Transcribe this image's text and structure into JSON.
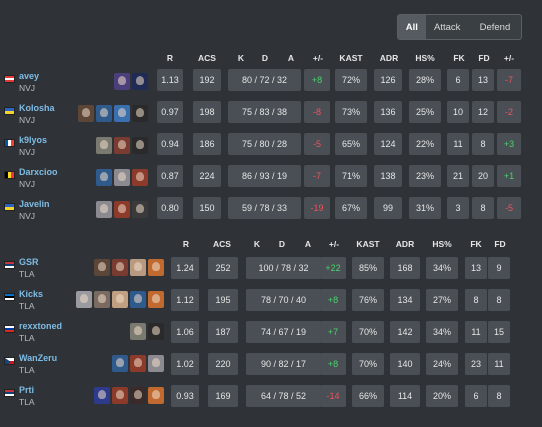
{
  "filter": {
    "options": [
      "All",
      "Attack",
      "Defend"
    ],
    "selected": "All"
  },
  "headers": [
    "R",
    "ACS",
    "K",
    "D",
    "A",
    "+/-",
    "KAST",
    "ADR",
    "HS%",
    "FK",
    "FD",
    "+/-"
  ],
  "team1": [
    {
      "name": "avey",
      "team": "NVJ",
      "flag": "lb",
      "agents": [
        "#4a3f7a",
        "#1f2b55"
      ],
      "r": "1.13",
      "acs": "192",
      "kda": "80 / 72 / 32",
      "pm": "+8",
      "pm_sign": "pos",
      "kast": "72%",
      "adr": "126",
      "hs": "28%",
      "fk": "6",
      "fd": "13",
      "fkpm": "-7",
      "fkpm_sign": "neg"
    },
    {
      "name": "Kolosha",
      "team": "NVJ",
      "flag": "ua",
      "agents": [
        "#5b4638",
        "#2e5a8c",
        "#3a6fb0",
        "#2a2a2a"
      ],
      "r": "0.97",
      "acs": "198",
      "kda": "75 / 83 / 38",
      "pm": "-8",
      "pm_sign": "neg",
      "kast": "73%",
      "adr": "136",
      "hs": "25%",
      "fk": "10",
      "fd": "12",
      "fkpm": "-2",
      "fkpm_sign": "neg"
    },
    {
      "name": "k9lyos",
      "team": "NVJ",
      "flag": "fr",
      "agents": [
        "#7a7a70",
        "#7a3b30",
        "#2a2a2a"
      ],
      "r": "0.94",
      "acs": "186",
      "kda": "75 / 80 / 28",
      "pm": "-5",
      "pm_sign": "neg",
      "kast": "65%",
      "adr": "124",
      "hs": "22%",
      "fk": "11",
      "fd": "8",
      "fkpm": "+3",
      "fkpm_sign": "pos"
    },
    {
      "name": "Darxcioo",
      "team": "NVJ",
      "flag": "be",
      "agents": [
        "#2e5a8c",
        "#8a8a90",
        "#8c3a2a"
      ],
      "r": "0.87",
      "acs": "224",
      "kda": "86 / 93 / 19",
      "pm": "-7",
      "pm_sign": "neg",
      "kast": "71%",
      "adr": "138",
      "hs": "23%",
      "fk": "21",
      "fd": "20",
      "fkpm": "+1",
      "fkpm_sign": "pos"
    },
    {
      "name": "Javelin",
      "team": "NVJ",
      "flag": "ua",
      "agents": [
        "#8a8a90",
        "#8c3a2a",
        "#3a3a3a"
      ],
      "r": "0.80",
      "acs": "150",
      "kda": "59 / 78 / 33",
      "pm": "-19",
      "pm_sign": "neg",
      "kast": "67%",
      "adr": "99",
      "hs": "31%",
      "fk": "3",
      "fd": "8",
      "fkpm": "-5",
      "fkpm_sign": "neg"
    }
  ],
  "team2": [
    {
      "name": "GSR",
      "team": "TLA",
      "flag": "rs",
      "agents": [
        "#5b4638",
        "#7a3b30",
        "#b89a80",
        "#c06a30"
      ],
      "r": "1.24",
      "acs": "252",
      "kda": "100 / 78 / 32",
      "pm": "+22",
      "pm_sign": "pos",
      "kast": "85%",
      "adr": "168",
      "hs": "34%",
      "fk": "13",
      "fd": "9"
    },
    {
      "name": "Kicks",
      "team": "TLA",
      "flag": "ee",
      "agents": [
        "#9a9aa0",
        "#7a6a60",
        "#c0a080",
        "#2e5a8c",
        "#c06a30"
      ],
      "r": "1.12",
      "acs": "195",
      "kda": "78 / 70 / 40",
      "pm": "+8",
      "pm_sign": "pos",
      "kast": "76%",
      "adr": "134",
      "hs": "27%",
      "fk": "8",
      "fd": "8"
    },
    {
      "name": "rexxtoned",
      "team": "TLA",
      "flag": "ru",
      "agents": [
        "#7a7a70",
        "#2a2a2a"
      ],
      "r": "1.06",
      "acs": "187",
      "kda": "74 / 67 / 19",
      "pm": "+7",
      "pm_sign": "pos",
      "kast": "70%",
      "adr": "142",
      "hs": "34%",
      "fk": "11",
      "fd": "15"
    },
    {
      "name": "WanZeru",
      "team": "TLA",
      "flag": "cz",
      "agents": [
        "#2e5a8c",
        "#8c3a2a",
        "#8a8a90"
      ],
      "r": "1.02",
      "acs": "220",
      "kda": "90 / 82 / 17",
      "pm": "+8",
      "pm_sign": "pos",
      "kast": "70%",
      "adr": "140",
      "hs": "24%",
      "fk": "23",
      "fd": "11"
    },
    {
      "name": "Prti",
      "team": "TLA",
      "flag": "rs",
      "agents": [
        "#2e3a8c",
        "#8c3a2a",
        "#3a2a2a",
        "#c06a30"
      ],
      "r": "0.93",
      "acs": "169",
      "kda": "64 / 78 / 52",
      "pm": "-14",
      "pm_sign": "neg",
      "kast": "66%",
      "adr": "114",
      "hs": "20%",
      "fk": "6",
      "fd": "8"
    }
  ]
}
